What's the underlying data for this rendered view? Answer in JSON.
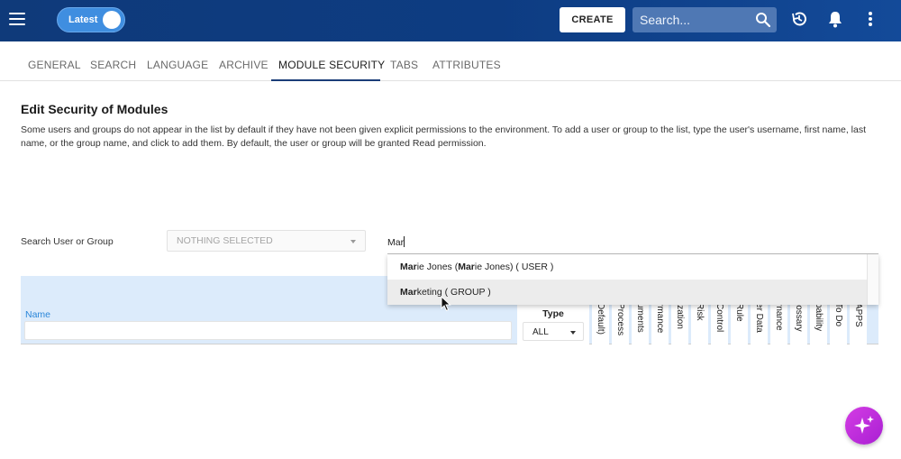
{
  "header": {
    "version_toggle_label": "Latest",
    "create_label": "CREATE",
    "search_placeholder": "Search..."
  },
  "tabs": [
    {
      "label": "GENERAL"
    },
    {
      "label": "SEARCH"
    },
    {
      "label": "LANGUAGE"
    },
    {
      "label": "ARCHIVE"
    },
    {
      "label": "MODULE SECURITY",
      "active": true
    },
    {
      "label": "TABS"
    },
    {
      "label": "ATTRIBUTES"
    }
  ],
  "section": {
    "title": "Edit Security of Modules",
    "description": "Some users and groups do not appear in the list by default if they have not been given explicit permissions to the environment. To add a user or group to the list, type the user's username, first name, last name, or the group name, and click to add them. By default, the user or group will be granted Read permission."
  },
  "search": {
    "label": "Search User or Group",
    "select_value": "NOTHING SELECTED",
    "input_value": "Mar"
  },
  "suggestions": [
    {
      "match1": "Mar",
      "rest1": "ie Jones (",
      "match2": "Mar",
      "rest2": "ie Jones) ( USER )"
    },
    {
      "match1": "Mar",
      "rest1": "keting ( GROUP )",
      "match2": "",
      "rest2": ""
    }
  ],
  "table": {
    "name_header": "Name",
    "type_header": "Type",
    "type_value": "ALL",
    "columns": [
      "Default)",
      "Process",
      "uments",
      "rmance",
      "ization",
      "Risk",
      "Control",
      "Rule",
      "er Data",
      "rnance",
      "lossary",
      "pability",
      "To Do",
      "APPS"
    ]
  },
  "colors": {
    "header_bg": "#0d3c82",
    "accent": "#2a86d9",
    "fab": "#c42fdc"
  }
}
